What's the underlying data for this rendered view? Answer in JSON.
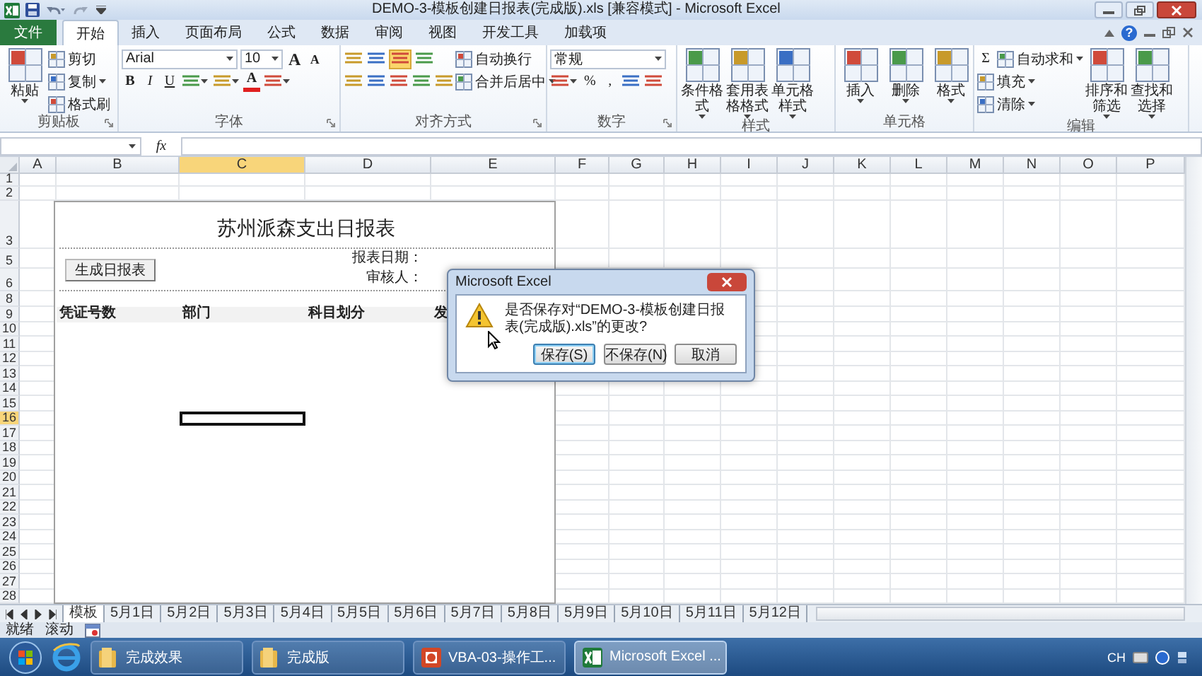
{
  "window": {
    "title": "DEMO-3-模板创建日报表(完成版).xls  [兼容模式] - Microsoft Excel"
  },
  "ribbon_tabs": [
    {
      "label": "文件",
      "kind": "file",
      "selected": false
    },
    {
      "label": "开始",
      "kind": "tab",
      "selected": true
    },
    {
      "label": "插入",
      "kind": "tab",
      "selected": false
    },
    {
      "label": "页面布局",
      "kind": "tab",
      "selected": false
    },
    {
      "label": "公式",
      "kind": "tab",
      "selected": false
    },
    {
      "label": "数据",
      "kind": "tab",
      "selected": false
    },
    {
      "label": "审阅",
      "kind": "tab",
      "selected": false
    },
    {
      "label": "视图",
      "kind": "tab",
      "selected": false
    },
    {
      "label": "开发工具",
      "kind": "tab",
      "selected": false
    },
    {
      "label": "加载项",
      "kind": "tab",
      "selected": false
    }
  ],
  "help_label": "?",
  "ribbon_groups": [
    {
      "label": "剪贴板",
      "launcher": true,
      "items": [
        {
          "kind": "large",
          "label": "粘贴",
          "dropdown": true
        },
        {
          "kind": "stack",
          "lines": [
            {
              "items": [
                {
                  "kind": "small",
                  "label": "剪切",
                  "dropdown": false
                }
              ]
            },
            {
              "items": [
                {
                  "kind": "small",
                  "label": "复制",
                  "dropdown": true
                }
              ]
            },
            {
              "items": [
                {
                  "kind": "small",
                  "label": "格式刷",
                  "dropdown": false
                }
              ]
            }
          ]
        }
      ]
    },
    {
      "label": "字体",
      "launcher": true,
      "items": [
        {
          "kind": "stack",
          "lines": [
            {
              "items": [
                {
                  "kind": "wide-combo",
                  "value": "Arial"
                },
                {
                  "kind": "narrow-combo",
                  "value": "10"
                },
                {
                  "kind": "grow",
                  "text": "A"
                },
                {
                  "kind": "shrink",
                  "text": "A"
                }
              ]
            },
            {
              "items": [
                {
                  "kind": "bold",
                  "text": "B"
                },
                {
                  "kind": "italic",
                  "text": "I"
                },
                {
                  "kind": "underline",
                  "text": "U"
                },
                {
                  "kind": "icon",
                  "dropdown": true
                },
                {
                  "kind": "icon",
                  "dropdown": true
                },
                {
                  "kind": "color",
                  "text": "A"
                },
                {
                  "kind": "icon",
                  "dropdown": true
                }
              ]
            }
          ]
        }
      ]
    },
    {
      "label": "对齐方式",
      "launcher": true,
      "items": [
        {
          "kind": "stack",
          "lines": [
            {
              "items": [
                {
                  "kind": "icon",
                  "selected": false
                },
                {
                  "kind": "icon",
                  "selected": false
                },
                {
                  "kind": "icon",
                  "selected": true
                },
                {
                  "kind": "icon",
                  "selected": false
                }
              ]
            },
            {
              "items": [
                {
                  "kind": "icon",
                  "selected": false
                },
                {
                  "kind": "icon",
                  "selected": false
                },
                {
                  "kind": "icon",
                  "selected": false
                },
                {
                  "kind": "icon",
                  "selected": false
                },
                {
                  "kind": "icon",
                  "selected": false
                }
              ]
            }
          ]
        },
        {
          "kind": "stack",
          "lines": [
            {
              "items": [
                {
                  "kind": "small",
                  "label": "自动换行",
                  "dropdown": false
                }
              ]
            },
            {
              "items": [
                {
                  "kind": "small",
                  "label": "合并后居中",
                  "dropdown": true
                }
              ]
            }
          ]
        }
      ]
    },
    {
      "label": "数字",
      "launcher": true,
      "items": [
        {
          "kind": "stack",
          "lines": [
            {
              "items": [
                {
                  "kind": "wide-combo",
                  "value": "常规"
                }
              ]
            },
            {
              "items": [
                {
                  "kind": "icon",
                  "dropdown": true
                },
                {
                  "kind": "glyph",
                  "text": "%"
                },
                {
                  "kind": "glyph",
                  "text": ","
                },
                {
                  "kind": "icon",
                  "dropdown": false
                },
                {
                  "kind": "icon",
                  "dropdown": false
                }
              ]
            }
          ]
        }
      ]
    },
    {
      "label": "样式",
      "launcher": false,
      "items": [
        {
          "kind": "large",
          "label": "条件格式",
          "dropdown": true
        },
        {
          "kind": "large",
          "label": "套用表格格式",
          "dropdown": true
        },
        {
          "kind": "large",
          "label": "单元格样式",
          "dropdown": true
        }
      ]
    },
    {
      "label": "单元格",
      "launcher": false,
      "items": [
        {
          "kind": "large",
          "label": "插入",
          "dropdown": true
        },
        {
          "kind": "large",
          "label": "删除",
          "dropdown": true
        },
        {
          "kind": "large",
          "label": "格式",
          "dropdown": true
        }
      ]
    },
    {
      "label": "编辑",
      "launcher": false,
      "items": [
        {
          "kind": "stack",
          "lines": [
            {
              "items": [
                {
                  "kind": "glyph",
                  "text": "Σ"
                },
                {
                  "kind": "small",
                  "label": "自动求和",
                  "dropdown": true
                }
              ]
            },
            {
              "items": [
                {
                  "kind": "small",
                  "label": "填充",
                  "dropdown": true
                }
              ]
            },
            {
              "items": [
                {
                  "kind": "small",
                  "label": "清除",
                  "dropdown": true
                }
              ]
            }
          ]
        },
        {
          "kind": "large",
          "label": "排序和筛选",
          "dropdown": true
        },
        {
          "kind": "large",
          "label": "查找和选择",
          "dropdown": true
        }
      ]
    }
  ],
  "formula_bar": {
    "function_label": "fx"
  },
  "sheet": {
    "columns": [
      {
        "label": "A",
        "selected": false
      },
      {
        "label": "B",
        "selected": false
      },
      {
        "label": "C",
        "selected": true
      },
      {
        "label": "D",
        "selected": false
      },
      {
        "label": "E",
        "selected": false
      },
      {
        "label": "F",
        "selected": false
      },
      {
        "label": "G",
        "selected": false
      },
      {
        "label": "H",
        "selected": false
      },
      {
        "label": "I",
        "selected": false
      },
      {
        "label": "J",
        "selected": false
      },
      {
        "label": "K",
        "selected": false
      },
      {
        "label": "L",
        "selected": false
      },
      {
        "label": "M",
        "selected": false
      },
      {
        "label": "N",
        "selected": false
      },
      {
        "label": "O",
        "selected": false
      },
      {
        "label": "P",
        "selected": false
      }
    ],
    "rows": [
      {
        "label": "1",
        "selected": false
      },
      {
        "label": "2",
        "selected": false
      },
      {
        "label": "3",
        "selected": false
      },
      {
        "label": "5",
        "selected": false
      },
      {
        "label": "6",
        "selected": false
      },
      {
        "label": "8",
        "selected": false
      },
      {
        "label": "9",
        "selected": false
      },
      {
        "label": "10",
        "selected": false
      },
      {
        "label": "11",
        "selected": false
      },
      {
        "label": "12",
        "selected": false
      },
      {
        "label": "13",
        "selected": false
      },
      {
        "label": "14",
        "selected": false
      },
      {
        "label": "15",
        "selected": false
      },
      {
        "label": "16",
        "selected": true
      },
      {
        "label": "17",
        "selected": false
      },
      {
        "label": "18",
        "selected": false
      },
      {
        "label": "19",
        "selected": false
      },
      {
        "label": "20",
        "selected": false
      },
      {
        "label": "21",
        "selected": false
      },
      {
        "label": "22",
        "selected": false
      },
      {
        "label": "23",
        "selected": false
      },
      {
        "label": "24",
        "selected": false
      },
      {
        "label": "25",
        "selected": false
      },
      {
        "label": "26",
        "selected": false
      },
      {
        "label": "27",
        "selected": false
      },
      {
        "label": "28",
        "selected": false
      }
    ],
    "report": {
      "title": "苏州派森支出日报表",
      "button": "生成日报表",
      "fields": [
        "报表日期：",
        "审核人："
      ],
      "headers": [
        "凭证号数",
        "部门",
        "科目划分",
        "发"
      ]
    }
  },
  "sheet_tabs": [
    {
      "label": "模板",
      "selected": true
    },
    {
      "label": "5月1日",
      "selected": false
    },
    {
      "label": "5月2日",
      "selected": false
    },
    {
      "label": "5月3日",
      "selected": false
    },
    {
      "label": "5月4日",
      "selected": false
    },
    {
      "label": "5月5日",
      "selected": false
    },
    {
      "label": "5月6日",
      "selected": false
    },
    {
      "label": "5月7日",
      "selected": false
    },
    {
      "label": "5月8日",
      "selected": false
    },
    {
      "label": "5月9日",
      "selected": false
    },
    {
      "label": "5月10日",
      "selected": false
    },
    {
      "label": "5月11日",
      "selected": false
    },
    {
      "label": "5月12日",
      "selected": false
    }
  ],
  "status_bar": {
    "items": [
      "就绪",
      "滚动"
    ]
  },
  "dialog": {
    "title": "Microsoft Excel",
    "message": "是否保存对“DEMO-3-模板创建日报表(完成版).xls”的更改?",
    "buttons": [
      {
        "label": "保存(S)",
        "selected": true
      },
      {
        "label": "不保存(N)",
        "selected": false
      },
      {
        "label": "取消",
        "selected": false
      }
    ]
  },
  "taskbar": {
    "items": [
      {
        "label": "完成效果",
        "kind": "folder",
        "selected": false
      },
      {
        "label": "完成版",
        "kind": "folder",
        "selected": false
      },
      {
        "label": "VBA-03-操作工...",
        "kind": "slides",
        "selected": false
      },
      {
        "label": "Microsoft Excel ...",
        "kind": "spreadsheet",
        "selected": true
      }
    ],
    "language": "CH"
  }
}
